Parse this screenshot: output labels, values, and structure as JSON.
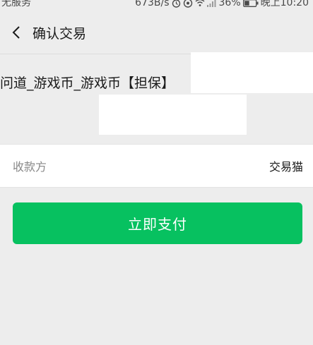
{
  "status_bar": {
    "carrier": "无服务",
    "speed": "673B/s",
    "battery": "36%",
    "time": "晚上10:20"
  },
  "nav": {
    "title": "确认交易"
  },
  "order": {
    "product_name": "问道_游戏币_游戏币【担保】"
  },
  "payee": {
    "label": "收款方",
    "value": "交易猫"
  },
  "actions": {
    "pay_label": "立即支付"
  },
  "colors": {
    "background": "#ededed",
    "primary": "#07c160"
  }
}
